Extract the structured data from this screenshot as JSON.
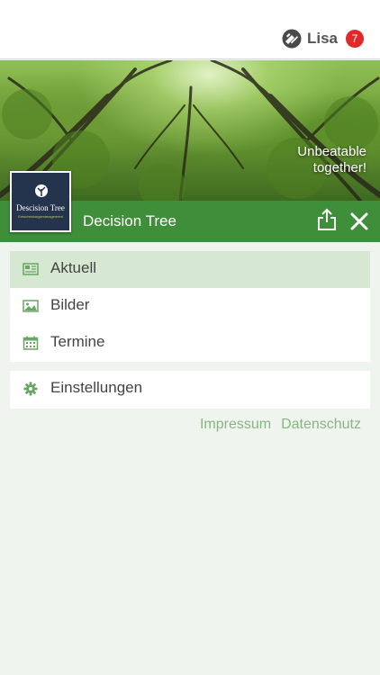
{
  "header": {
    "user_name": "Lisa",
    "notification_count": "7"
  },
  "hero": {
    "tagline_line1": "Unbeatable",
    "tagline_line2": "together!"
  },
  "brand": {
    "title": "Decision Tree",
    "logo_name": "Descision Tree",
    "logo_subtitle": "Entscheidungsmanagement"
  },
  "menu": {
    "items": [
      {
        "label": "Aktuell",
        "icon": "newspaper-icon",
        "active": true
      },
      {
        "label": "Bilder",
        "icon": "image-icon",
        "active": false
      },
      {
        "label": "Termine",
        "icon": "calendar-icon",
        "active": false
      }
    ],
    "settings_label": "Einstellungen",
    "settings_icon": "gear-icon"
  },
  "footer": {
    "impressum": "Impressum",
    "datenschutz": "Datenschutz"
  },
  "colors": {
    "brand_green": "#3f8f3a",
    "active_row": "#d6e8d2",
    "background": "#eff5ee",
    "link": "#86b67f",
    "badge": "#e02a2a",
    "icon": "#6aa663"
  }
}
